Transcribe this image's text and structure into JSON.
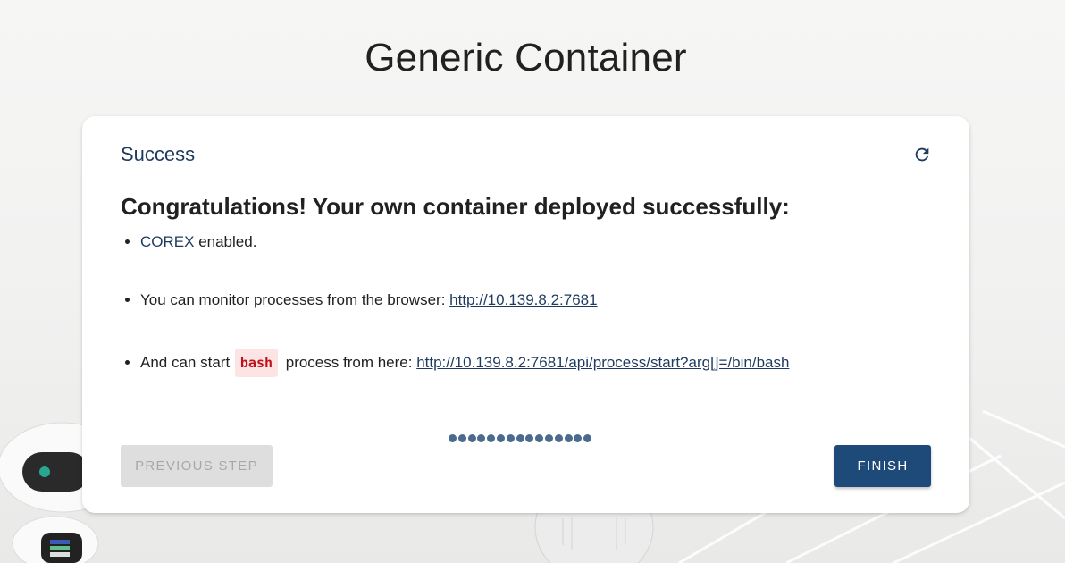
{
  "page": {
    "title": "Generic Container"
  },
  "card": {
    "header": "Success",
    "headline": "Congratulations! Your own container deployed successfully:",
    "items": [
      {
        "link": "COREX",
        "text": " enabled."
      },
      {
        "text": "You can monitor processes from the browser: ",
        "link": "http://10.139.8.2:7681"
      },
      {
        "text_before": "And can start ",
        "code": "bash",
        "text_after": " process from here: ",
        "link": "http://10.139.8.2:7681/api/process/start?arg[]=/bin/bash"
      }
    ]
  },
  "stepper": {
    "total_steps": 15,
    "active_step": 15
  },
  "buttons": {
    "previous": "PREVIOUS STEP",
    "finish": "FINISH"
  },
  "icons": {
    "refresh": "refresh-icon"
  },
  "colors": {
    "accent": "#1e4a7a",
    "header": "#1e3a5f",
    "code_text": "#c0101a",
    "code_bg": "#fde4e4"
  }
}
